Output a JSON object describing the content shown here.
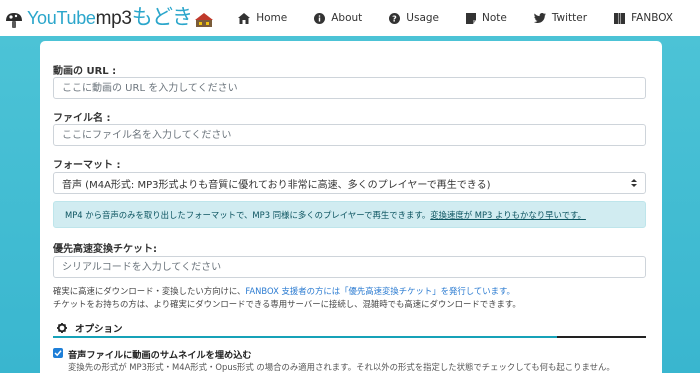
{
  "brand": {
    "text_youtube": "YouTube",
    "text_mp3": "mp3",
    "text_jp": "もどき"
  },
  "nav": [
    {
      "label": "Home",
      "icon": "home-icon"
    },
    {
      "label": "About",
      "icon": "info-icon"
    },
    {
      "label": "Usage",
      "icon": "question-icon"
    },
    {
      "label": "Note",
      "icon": "note-icon"
    },
    {
      "label": "Twitter",
      "icon": "twitter-icon"
    },
    {
      "label": "FANBOX",
      "icon": "fanbox-icon"
    }
  ],
  "form": {
    "url_label": "動画の URL :",
    "url_placeholder": "ここに動画の URL を入力してください",
    "filename_label": "ファイル名 :",
    "filename_placeholder": "ここにファイル名を入力してください",
    "format_label": "フォーマット :",
    "format_selected": "音声 (M4A形式: MP3形式よりも音質に優れており非常に高速、多くのプレイヤーで再生できる)",
    "info_text": "MP4 から音声のみを取り出したフォーマットで、MP3 同様に多くのプレイヤーで再生できます。",
    "info_text_underlined": "変換速度が MP3 よりもかなり早いです。",
    "ticket_label": "優先高速変換チケット:",
    "ticket_placeholder": "シリアルコードを入力してください",
    "note_line1_a": "確実に高速にダウンロード・変換したい方向けに、",
    "note_line1_link": "FANBOX 支援者の方には「優先高速変換チケット」を発行しています。",
    "note_line2": "チケットをお持ちの方は、より確実にダウンロードできる専用サーバーに接続し、混雑時でも高速にダウンロードできます。",
    "options_label": "オプション",
    "progress": 0.85,
    "thumbnail_checked": true,
    "thumbnail_label": "音声ファイルに動画のサムネイルを埋め込む",
    "thumbnail_help": "変換先の形式が MP3形式・M4A形式・Opus形式 の場合のみ適用されます。それ以外の形式を指定した状態でチェックしても何も起こりません。"
  },
  "colors": {
    "accent": "#2ba6cb",
    "background_band": "#3fbad1",
    "info_bg": "#d1ecf1",
    "link": "#2b7bd1",
    "checkbox": "#1e7fd8"
  }
}
